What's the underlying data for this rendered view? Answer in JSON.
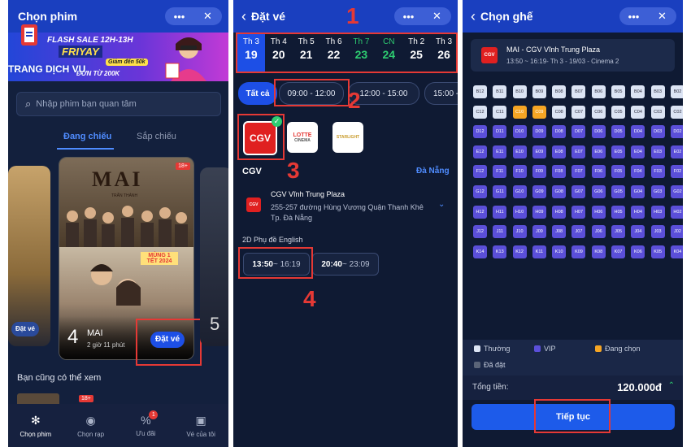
{
  "panel1": {
    "title": "Chọn phim",
    "capsule_more": "•••",
    "capsule_close": "✕",
    "banner": {
      "line1": "FLASH SALE 12H-13H",
      "line2": "FRIYAY",
      "line3": "ĐƠN TỪ 200K",
      "badge": "Giảm đến 50k",
      "watermark": "TRANG DỊCH VỤ"
    },
    "search_placeholder": "Nhập phim bạn quan tâm",
    "tab_now": "Đang chiếu",
    "tab_soon": "Sắp chiếu",
    "left_poster_button": "Đặt vé",
    "main_poster": {
      "age": "18+",
      "title_art": "MAI",
      "director": "TRẤN THÀNH",
      "tet_badge": "MÙNG 1 TẾT 2024",
      "rank": "4",
      "name": "MAI",
      "duration": "2 giờ 11 phút",
      "button": "Đặt vé"
    },
    "right_rank": "5",
    "section_title": "Bạn cũng có thể xem",
    "teaser_age": "18+",
    "nav": [
      {
        "label": "Chọn phim",
        "icon": "film-reel-icon",
        "glyph": "✻",
        "active": true
      },
      {
        "label": "Chọn rạp",
        "icon": "cinema-icon",
        "glyph": "◉",
        "active": false
      },
      {
        "label": "Ưu đãi",
        "icon": "discount-icon",
        "glyph": "%",
        "active": false,
        "badge": "1"
      },
      {
        "label": "Vé của tôi",
        "icon": "ticket-icon",
        "glyph": "▣",
        "active": false
      }
    ]
  },
  "panel2": {
    "title": "Đặt vé",
    "capsule_more": "•••",
    "capsule_close": "✕",
    "dates": [
      {
        "dow": "Th 3",
        "day": "19",
        "selected": true
      },
      {
        "dow": "Th 4",
        "day": "20"
      },
      {
        "dow": "Th 5",
        "day": "21"
      },
      {
        "dow": "Th 6",
        "day": "22"
      },
      {
        "dow": "Th 7",
        "day": "23",
        "weekend": true
      },
      {
        "dow": "CN",
        "day": "24",
        "weekend": true
      },
      {
        "dow": "Th 2",
        "day": "25"
      },
      {
        "dow": "Th 3",
        "day": "26"
      }
    ],
    "filters": {
      "all": "Tất cả",
      "t1": "09:00 - 12:00",
      "t2": "12:00 - 15:00",
      "t3": "15:00 -"
    },
    "logos": {
      "cgv": "CGV",
      "lotte": "LOTTE",
      "lotte_sub": "CINEMA",
      "starlight": "STARLIGHT"
    },
    "brand": "CGV",
    "city": "Đà Nẵng",
    "cinema_name": "CGV Vĩnh Trung Plaza",
    "cinema_address": "255-257 đường Hùng Vương Quận Thanh Khê Tp. Đà Nẵng",
    "format": "2D Phụ đề English",
    "showtimes": [
      {
        "start": "13:50",
        "end": " ~ 16:19"
      },
      {
        "start": "20:40",
        "end": " ~ 23:09"
      }
    ],
    "annotations": [
      "1",
      "2",
      "3",
      "4"
    ]
  },
  "panel3": {
    "title": "Chọn ghế",
    "capsule_more": "•••",
    "capsule_close": "✕",
    "movie_title": "MAI - CGV Vĩnh Trung Plaza",
    "movie_meta": "13:50 ~ 16:19- Th 3 - 19/03 - Cinema 2",
    "logo": "CGV",
    "rows": [
      {
        "row": "B",
        "type": "n",
        "seats": [
          "B12",
          "B11",
          "B10",
          "B09",
          "B08",
          "B07",
          "B06",
          "B05",
          "B04",
          "B03",
          "B02"
        ]
      },
      {
        "row": "C",
        "type": "n",
        "seats": [
          "C12",
          "C11",
          "C10",
          "C09",
          "C08",
          "C07",
          "C06",
          "C05",
          "C04",
          "C03",
          "C02"
        ],
        "selected": [
          "C10",
          "C09"
        ]
      },
      {
        "row": "D",
        "type": "v",
        "seats": [
          "D12",
          "D11",
          "D10",
          "D09",
          "D08",
          "D07",
          "D06",
          "D05",
          "D04",
          "D03",
          "D02"
        ]
      },
      {
        "row": "E",
        "type": "v",
        "seats": [
          "E12",
          "E11",
          "E10",
          "E09",
          "E08",
          "E07",
          "E06",
          "E05",
          "E04",
          "E03",
          "E02"
        ]
      },
      {
        "row": "F",
        "type": "v",
        "seats": [
          "F12",
          "F11",
          "F10",
          "F09",
          "F08",
          "F07",
          "F06",
          "F05",
          "F04",
          "F03",
          "F02"
        ]
      },
      {
        "row": "G",
        "type": "v",
        "seats": [
          "G12",
          "G11",
          "G10",
          "G09",
          "G08",
          "G07",
          "G06",
          "G05",
          "G04",
          "G03",
          "G02"
        ]
      },
      {
        "row": "H",
        "type": "v",
        "seats": [
          "H12",
          "H11",
          "H10",
          "H09",
          "H08",
          "H07",
          "H06",
          "H05",
          "H04",
          "H03",
          "H02"
        ]
      },
      {
        "row": "J",
        "type": "v",
        "seats": [
          "J12",
          "J11",
          "J10",
          "J09",
          "J08",
          "J07",
          "J06",
          "J05",
          "J04",
          "J03",
          "J02"
        ]
      },
      {
        "row": "K",
        "type": "v",
        "seats": [
          "K14",
          "K13",
          "K12",
          "K11",
          "K10",
          "K09",
          "K08",
          "K07",
          "K06",
          "K05",
          "K04"
        ]
      }
    ],
    "legend": {
      "normal": "Thường",
      "vip": "VIP",
      "choosing": "Đang chọn",
      "booked": "Đã đặt"
    },
    "total_label": "Tổng tiền:",
    "total_value": "120.000đ",
    "cta": "Tiếp tục"
  },
  "colors": {
    "accent": "#1d4fe6",
    "annotation": "#e53935",
    "selected_seat": "#f5a524",
    "vip_seat": "#5b4fd9",
    "weekend": "#2ecc71"
  }
}
